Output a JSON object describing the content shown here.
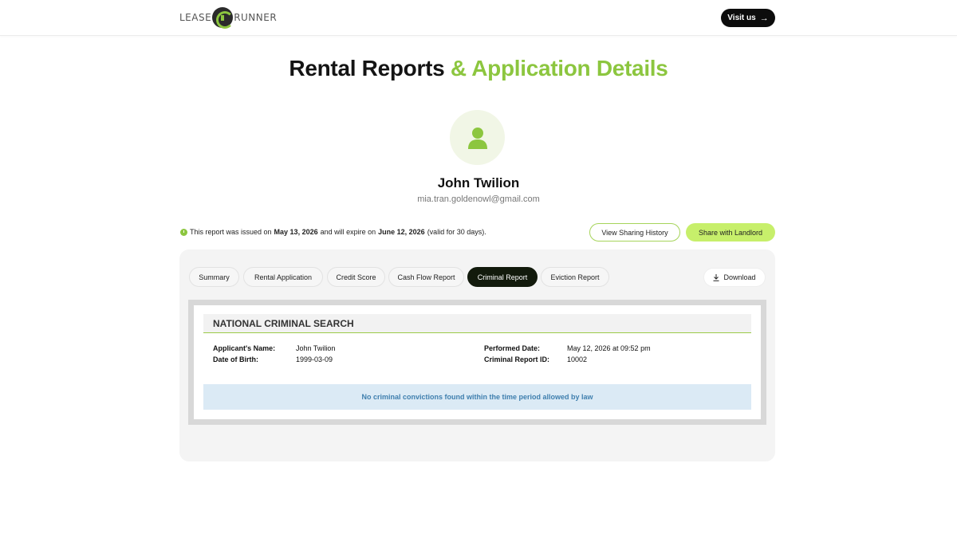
{
  "header": {
    "logo_left": "LEASE",
    "logo_right": "RUNNER",
    "visit_label": "Visit us"
  },
  "title": {
    "part1": "Rental Reports",
    "part2": "& Application Details"
  },
  "profile": {
    "name": "John Twilion",
    "email": "mia.tran.goldenowl@gmail.com"
  },
  "notice": {
    "prefix": "This report was issued on",
    "issued_date": "May 13, 2026",
    "middle": "and will expire on",
    "expire_date": "June 12, 2026",
    "suffix": "(valid for 30 days)."
  },
  "actions": {
    "sharing_history": "View Sharing History",
    "share_landlord": "Share with Landlord"
  },
  "tabs": [
    {
      "label": "Summary"
    },
    {
      "label": "Rental Application"
    },
    {
      "label": "Credit Score"
    },
    {
      "label": "Cash Flow Report"
    },
    {
      "label": "Criminal Report",
      "active": true
    },
    {
      "label": "Eviction Report"
    }
  ],
  "download_label": "Download",
  "report": {
    "title": "NATIONAL CRIMINAL SEARCH",
    "applicant_label": "Applicant's Name:",
    "applicant_value": "John Twilion",
    "dob_label": "Date of Birth:",
    "dob_value": "1999-03-09",
    "performed_label": "Performed Date:",
    "performed_value": "May 12, 2026 at 09:52 pm",
    "id_label": "Criminal Report ID:",
    "id_value": "10002",
    "status": "No criminal convictions found within the time period allowed by law"
  },
  "colors": {
    "accent_green": "#8cc63f",
    "button_green": "#c7ef6b",
    "dark": "#121a0c",
    "status_text": "#3f7fae"
  }
}
